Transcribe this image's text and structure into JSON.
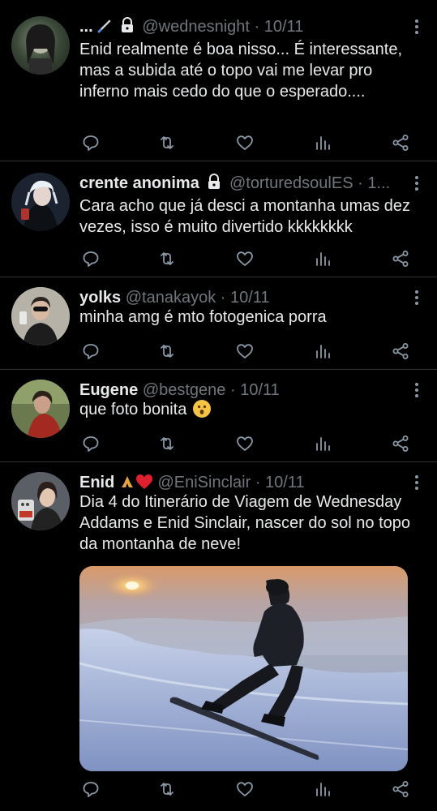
{
  "tweets": [
    {
      "name": "...",
      "handle": "@wednesnight",
      "date": "· 10/11",
      "text": "Enid realmente é boa nisso... É interessante, mas a subida até o topo vai me levar pro inferno mais cedo do que o esperado....",
      "locked": true
    },
    {
      "name": "crente anonima",
      "handle": "@torturedsoulES",
      "date": "· 1...",
      "text": "Cara acho que já desci a montanha umas dez vezes, isso é muito divertido kkkkkkkk",
      "locked": true
    },
    {
      "name": "yolks",
      "handle": "@tanakayok",
      "date": "· 10/11",
      "text": "minha amg é mto fotogenica porra",
      "locked": false
    },
    {
      "name": "Eugene",
      "handle": "@bestgene",
      "date": "· 10/11",
      "text": "que foto bonita",
      "locked": false
    },
    {
      "name": "Enid",
      "handle": "@EniSinclair",
      "date": "· 10/11",
      "text": "Dia 4 do Itinerário de Viagem de Wednesday Addams e Enid Sinclair, nascer do sol no topo da montanha de neve!",
      "locked": false
    }
  ],
  "icons": {
    "reply": "reply-icon",
    "retweet": "retweet-icon",
    "like": "heart-icon",
    "views": "analytics-icon",
    "share": "share-icon",
    "more": "more-options-icon",
    "lock": "lock-icon"
  },
  "colors": {
    "background": "#000000",
    "text": "#e7e9ea",
    "secondary": "#71767b",
    "divider": "#2f3336"
  }
}
